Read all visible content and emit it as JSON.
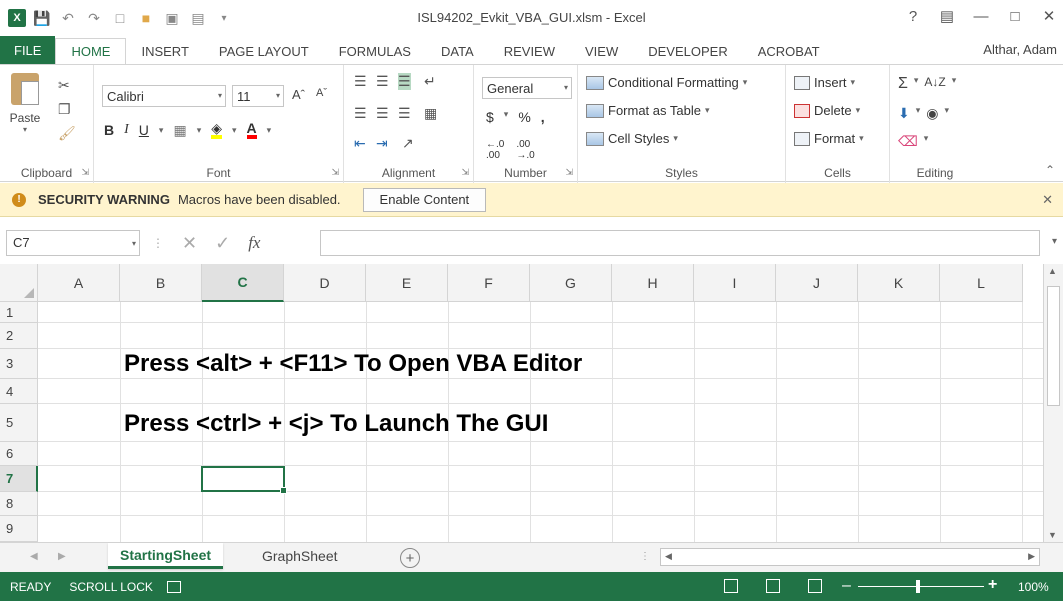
{
  "window": {
    "title": "ISL94202_Evkit_VBA_GUI.xlsm - Excel",
    "user": "Althar, Adam",
    "help": "?",
    "brand_color": "#217346"
  },
  "tabs": [
    {
      "label": "FILE"
    },
    {
      "label": "HOME"
    },
    {
      "label": "INSERT"
    },
    {
      "label": "PAGE LAYOUT"
    },
    {
      "label": "FORMULAS"
    },
    {
      "label": "DATA"
    },
    {
      "label": "REVIEW"
    },
    {
      "label": "VIEW"
    },
    {
      "label": "DEVELOPER"
    },
    {
      "label": "ACROBAT"
    }
  ],
  "ribbon": {
    "clipboard": {
      "label": "Clipboard",
      "paste": "Paste"
    },
    "font": {
      "label": "Font",
      "name": "Calibri",
      "size": "11",
      "bold": "B",
      "italic": "I",
      "underline": "U"
    },
    "alignment": {
      "label": "Alignment"
    },
    "number": {
      "label": "Number",
      "format": "General",
      "currency": "$",
      "percent": "%",
      "comma": ","
    },
    "styles": {
      "label": "Styles",
      "conditional": "Conditional Formatting",
      "table": "Format as Table",
      "cell_styles": "Cell Styles"
    },
    "cells": {
      "label": "Cells",
      "insert": "Insert",
      "delete": "Delete",
      "format": "Format"
    },
    "editing": {
      "label": "Editing"
    }
  },
  "security": {
    "title": "SECURITY WARNING",
    "message": "Macros have been disabled.",
    "button": "Enable Content"
  },
  "formula_bar": {
    "name_box": "C7",
    "fx": "fx",
    "value": ""
  },
  "grid": {
    "columns": [
      "A",
      "B",
      "C",
      "D",
      "E",
      "F",
      "G",
      "H",
      "I",
      "J",
      "K",
      "L"
    ],
    "rows": [
      "1",
      "2",
      "3",
      "4",
      "5",
      "6",
      "7",
      "8",
      "9"
    ],
    "active_cell": "C7",
    "cells": {
      "B3": "Press <alt> + <F11>  To Open VBA Editor",
      "B5": "Press <ctrl> + <j>  To Launch The GUI"
    }
  },
  "sheets": [
    {
      "label": "StartingSheet",
      "active": true
    },
    {
      "label": "GraphSheet",
      "active": false
    }
  ],
  "status": {
    "ready": "READY",
    "scroll_lock": "SCROLL LOCK",
    "zoom": "100%"
  }
}
